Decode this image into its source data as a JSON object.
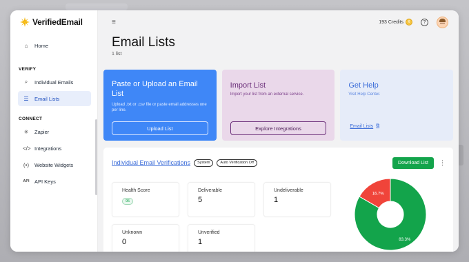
{
  "brand": {
    "name": "VerifiedEmail"
  },
  "sidebar": {
    "home": {
      "label": "Home",
      "icon": "home-icon"
    },
    "sections": [
      {
        "title": "VERIFY",
        "items": [
          {
            "label": "Individual Emails",
            "icon": "search-icon"
          },
          {
            "label": "Email Lists",
            "icon": "list-icon",
            "active": true
          }
        ]
      },
      {
        "title": "CONNECT",
        "items": [
          {
            "label": "Zapier",
            "icon": "asterisk-icon"
          },
          {
            "label": "Integrations",
            "icon": "code-icon"
          },
          {
            "label": "Website Widgets",
            "icon": "widget-icon"
          },
          {
            "label": "API Keys",
            "icon": "api-icon"
          }
        ]
      }
    ]
  },
  "topbar": {
    "credits": "193 Credits"
  },
  "page": {
    "title": "Email Lists",
    "subtitle": "1 list"
  },
  "cards": {
    "upload": {
      "title": "Paste or Upload an Email List",
      "description": "Upload .txt or .csv file or paste email addresses one per line.",
      "button": "Upload List"
    },
    "import": {
      "title": "Import List",
      "description": "Import your list from an external service.",
      "button": "Explore Integrations"
    },
    "help": {
      "title": "Get Help",
      "description": "Visit Help Center.",
      "link": "Email Lists"
    }
  },
  "list": {
    "title": "Individual Email Verifications",
    "badges": [
      "System",
      "Auto Verification Off"
    ],
    "download_label": "Download List",
    "stats": {
      "health": {
        "label": "Health Score",
        "value": "95"
      },
      "deliverable": {
        "label": "Deliverable",
        "value": "5"
      },
      "undeliverable": {
        "label": "Undeliverable",
        "value": "1"
      },
      "unknown": {
        "label": "Unknown",
        "value": "0"
      },
      "unverified": {
        "label": "Unverified",
        "value": "1"
      }
    }
  },
  "chart_data": {
    "type": "pie",
    "slices": [
      {
        "value": 83.3,
        "label": "83.3%",
        "color": "#13a44b"
      },
      {
        "value": 16.7,
        "label": "16.7%",
        "color": "#f0443a"
      }
    ]
  },
  "colors": {
    "primary": "#3f87f7",
    "success": "#13a44b",
    "danger": "#f0443a"
  }
}
